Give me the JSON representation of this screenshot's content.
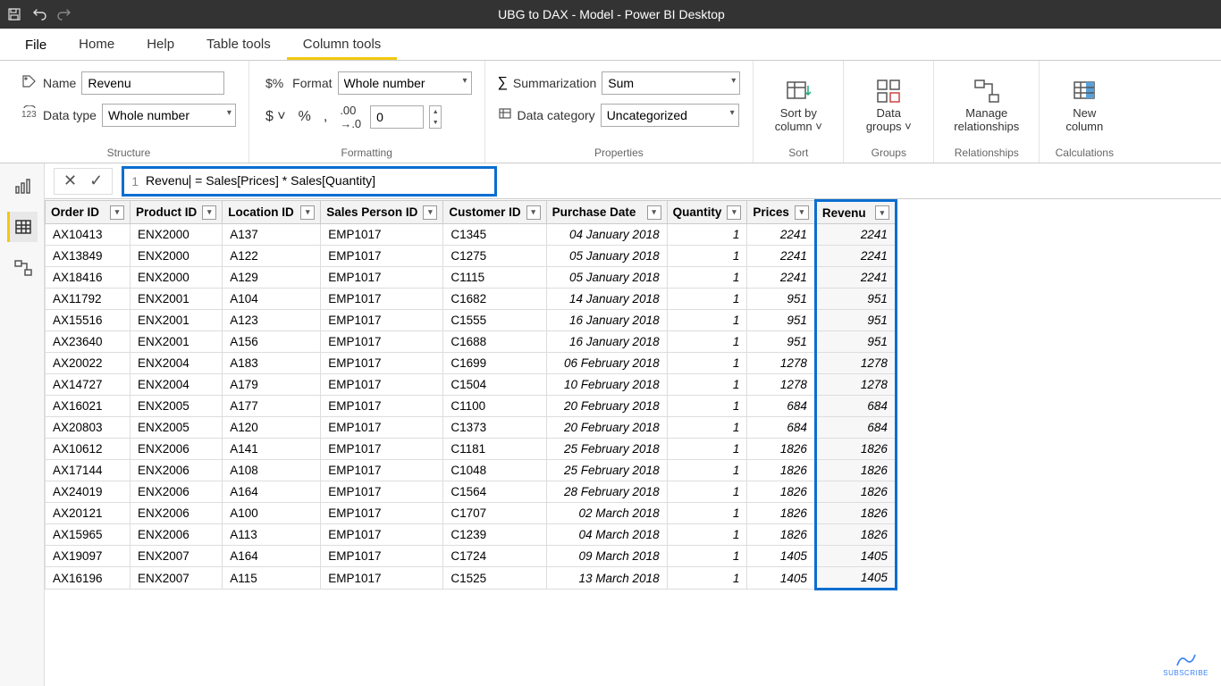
{
  "app_title": "UBG to DAX - Model - Power BI Desktop",
  "tabs": {
    "file": "File",
    "home": "Home",
    "help": "Help",
    "tabletools": "Table tools",
    "columntools": "Column tools"
  },
  "ribbon": {
    "structure": {
      "name_label": "Name",
      "name_value": "Revenu",
      "datatype_label": "Data type",
      "datatype_value": "Whole number",
      "group_label": "Structure"
    },
    "formatting": {
      "format_label": "Format",
      "format_value": "Whole number",
      "decimals": "0",
      "group_label": "Formatting"
    },
    "properties": {
      "summ_label": "Summarization",
      "summ_value": "Sum",
      "cat_label": "Data category",
      "cat_value": "Uncategorized",
      "group_label": "Properties"
    },
    "sort": {
      "btn": "Sort by\ncolumn ˅",
      "group_label": "Sort"
    },
    "groups": {
      "btn": "Data\ngroups ˅",
      "group_label": "Groups"
    },
    "relationships": {
      "btn": "Manage\nrelationships",
      "group_label": "Relationships"
    },
    "calculations": {
      "btn": "New\ncolumn",
      "group_label": "Calculations"
    }
  },
  "formula": {
    "line": "1",
    "text": "Revenu = Sales[Prices] * Sales[Quantity]"
  },
  "columns": [
    "Order ID",
    "Product ID",
    "Location ID",
    "Sales Person ID",
    "Customer ID",
    "Purchase Date",
    "Quantity",
    "Prices",
    "Revenu"
  ],
  "rows": [
    [
      "AX10413",
      "ENX2000",
      "A137",
      "EMP1017",
      "C1345",
      "04 January 2018",
      "1",
      "2241",
      "2241"
    ],
    [
      "AX13849",
      "ENX2000",
      "A122",
      "EMP1017",
      "C1275",
      "05 January 2018",
      "1",
      "2241",
      "2241"
    ],
    [
      "AX18416",
      "ENX2000",
      "A129",
      "EMP1017",
      "C1115",
      "05 January 2018",
      "1",
      "2241",
      "2241"
    ],
    [
      "AX11792",
      "ENX2001",
      "A104",
      "EMP1017",
      "C1682",
      "14 January 2018",
      "1",
      "951",
      "951"
    ],
    [
      "AX15516",
      "ENX2001",
      "A123",
      "EMP1017",
      "C1555",
      "16 January 2018",
      "1",
      "951",
      "951"
    ],
    [
      "AX23640",
      "ENX2001",
      "A156",
      "EMP1017",
      "C1688",
      "16 January 2018",
      "1",
      "951",
      "951"
    ],
    [
      "AX20022",
      "ENX2004",
      "A183",
      "EMP1017",
      "C1699",
      "06 February 2018",
      "1",
      "1278",
      "1278"
    ],
    [
      "AX14727",
      "ENX2004",
      "A179",
      "EMP1017",
      "C1504",
      "10 February 2018",
      "1",
      "1278",
      "1278"
    ],
    [
      "AX16021",
      "ENX2005",
      "A177",
      "EMP1017",
      "C1100",
      "20 February 2018",
      "1",
      "684",
      "684"
    ],
    [
      "AX20803",
      "ENX2005",
      "A120",
      "EMP1017",
      "C1373",
      "20 February 2018",
      "1",
      "684",
      "684"
    ],
    [
      "AX10612",
      "ENX2006",
      "A141",
      "EMP1017",
      "C1181",
      "25 February 2018",
      "1",
      "1826",
      "1826"
    ],
    [
      "AX17144",
      "ENX2006",
      "A108",
      "EMP1017",
      "C1048",
      "25 February 2018",
      "1",
      "1826",
      "1826"
    ],
    [
      "AX24019",
      "ENX2006",
      "A164",
      "EMP1017",
      "C1564",
      "28 February 2018",
      "1",
      "1826",
      "1826"
    ],
    [
      "AX20121",
      "ENX2006",
      "A100",
      "EMP1017",
      "C1707",
      "02 March 2018",
      "1",
      "1826",
      "1826"
    ],
    [
      "AX15965",
      "ENX2006",
      "A113",
      "EMP1017",
      "C1239",
      "04 March 2018",
      "1",
      "1826",
      "1826"
    ],
    [
      "AX19097",
      "ENX2007",
      "A164",
      "EMP1017",
      "C1724",
      "09 March 2018",
      "1",
      "1405",
      "1405"
    ],
    [
      "AX16196",
      "ENX2007",
      "A115",
      "EMP1017",
      "C1525",
      "13 March 2018",
      "1",
      "1405",
      "1405"
    ]
  ],
  "subscribe": "SUBSCRIBE"
}
